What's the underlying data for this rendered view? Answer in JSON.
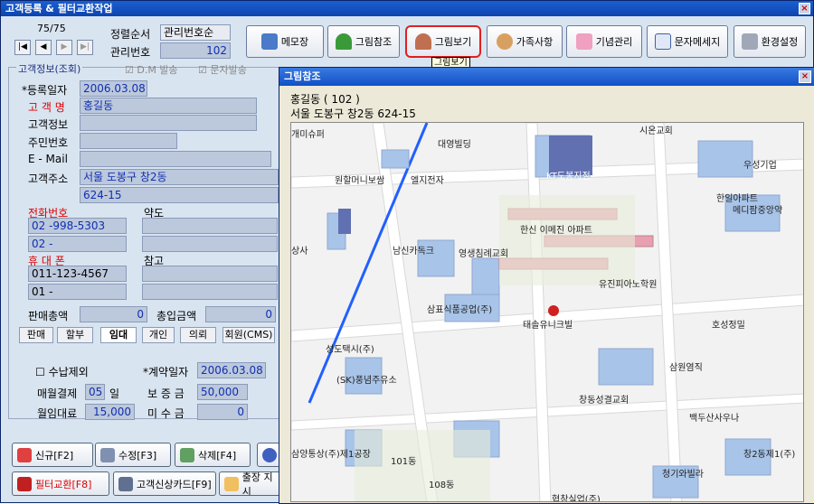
{
  "window": {
    "title": "고객등록 & 필터교환작업",
    "close": "×"
  },
  "nav": {
    "count": "75/75",
    "first": "|◀",
    "prev": "◀",
    "next": "▶",
    "last": "▶|"
  },
  "sort": {
    "label": "정렬순서",
    "value": "관리번호순",
    "mgmt_label": "관리번호",
    "mgmt_value": "102"
  },
  "toolbar": {
    "memo": "메모장",
    "pic_ref": "그림참조",
    "pic_view": "그림보기",
    "family": "가족사항",
    "anniv": "기념관리",
    "sms": "문자메세지",
    "settings": "환경설정",
    "tooltip": "그림보기"
  },
  "customer": {
    "section": "고객정보(조회)",
    "dm": "D.M 발송",
    "sms_send": "문자발송",
    "reg_date_label": "*등록일자",
    "reg_date": "2006.03.08",
    "name_label": "고 객 명",
    "name": "홍길동",
    "info_label": "고객정보",
    "id_label": "주민번호",
    "email_label": "E - Mail",
    "addr_label": "고객주소",
    "addr1": "서울 도봉구 창2동",
    "addr2": "624-15",
    "phone_label": "전화번호",
    "phone1": "02  -998-5303",
    "phone2": "02  -",
    "abbr_label": "약도",
    "mobile_label": "휴 대 폰",
    "mobile1": "011-123-4567",
    "mobile2": "01 -",
    "ref_label": "참고",
    "sales_label": "판매총액",
    "sales": "0",
    "income_label": "총입금액",
    "income": "0"
  },
  "tabs": [
    "판매",
    "할부",
    "임대",
    "개인",
    "의뢰",
    "회원(CMS)"
  ],
  "contract": {
    "exclude_label": "수납제외",
    "date_label": "*계약일자",
    "date": "2006.03.08",
    "monthly_label": "매월결제",
    "monthly_day": "05",
    "day_unit": "일",
    "deposit_label": "보 증 금",
    "deposit": "50,000",
    "rent_label": "월임대료",
    "rent": "15,000",
    "unpaid_label": "미 수 금",
    "unpaid": "0"
  },
  "bottom_buttons": {
    "new": "신규[F2]",
    "edit": "수정[F3]",
    "delete": "삭제[F4]",
    "filter": "필터교환[F8]",
    "card": "고객신상카드[F9]",
    "trip": "출장 지시"
  },
  "popup": {
    "title": "그림참조",
    "close": "×",
    "line1": "홍길동 ( 102 )",
    "line2": "서울 도봉구 창2동  624-15"
  },
  "map_labels": [
    "개미슈퍼",
    "대영빌딩",
    "KT도봉지점",
    "시온교회",
    "우성기업",
    "원할머니보쌈",
    "엘지전자",
    "한일아파트",
    "메디팜중앙약",
    "한신 이메진 아파트",
    "상사",
    "남신카독크",
    "영생침례교회",
    "유진피아노학원",
    "삼표식품공업(주)",
    "태솔유니크빌",
    "호성정밀",
    "성도택시(주)",
    "(SK)풍념주유소",
    "삼원염직",
    "창동성결교회",
    "백두산사우나",
    "삼양통상(주)제1공장",
    "101동",
    "108동",
    "창2동제1(주)",
    "청기와빌라",
    "협창실업(주)"
  ]
}
